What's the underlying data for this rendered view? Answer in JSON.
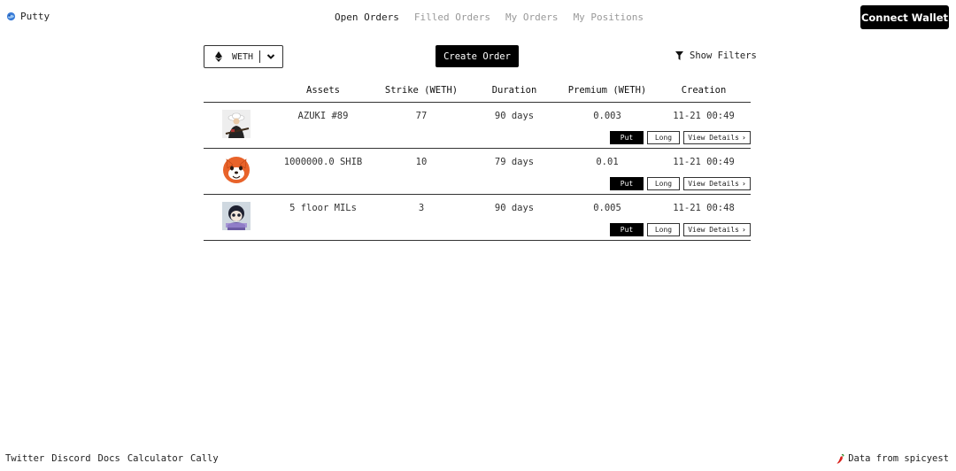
{
  "header": {
    "logo_text": "Putty",
    "nav": [
      "Open Orders",
      "Filled Orders",
      "My Orders",
      "My Positions"
    ],
    "active_nav": "Open Orders",
    "connect_label": "Connect Wallet"
  },
  "controls": {
    "token": "WETH",
    "create_label": "Create Order",
    "filters_label": "Show Filters"
  },
  "table": {
    "headers": [
      "Assets",
      "Strike (WETH)",
      "Duration",
      "Premium (WETH)",
      "Creation"
    ],
    "rows": [
      {
        "asset": "AZUKI #89",
        "strike": "77",
        "duration": "90 days",
        "premium": "0.003",
        "creation": "11-21 00:49",
        "type": "Put",
        "side": "Long",
        "details_label": "View Details",
        "thumb_icon": "azuki-nft-thumbnail"
      },
      {
        "asset": "1000000.0 SHIB",
        "strike": "10",
        "duration": "79 days",
        "premium": "0.01",
        "creation": "11-21 00:49",
        "type": "Put",
        "side": "Long",
        "details_label": "View Details",
        "thumb_icon": "shib-token-thumbnail"
      },
      {
        "asset": "5 floor MILs",
        "strike": "3",
        "duration": "90 days",
        "premium": "0.005",
        "creation": "11-21 00:48",
        "type": "Put",
        "side": "Long",
        "details_label": "View Details",
        "thumb_icon": "milady-nft-thumbnail"
      }
    ]
  },
  "footer": {
    "links": [
      "Twitter",
      "Discord",
      "Docs",
      "Calculator",
      "Cally"
    ],
    "data_source": "Data from spicyest"
  },
  "colors": {
    "primary": "#000000",
    "text": "#222222",
    "muted": "#999999",
    "shib_orange": "#e8632a",
    "pepper_red": "#d9231d"
  }
}
